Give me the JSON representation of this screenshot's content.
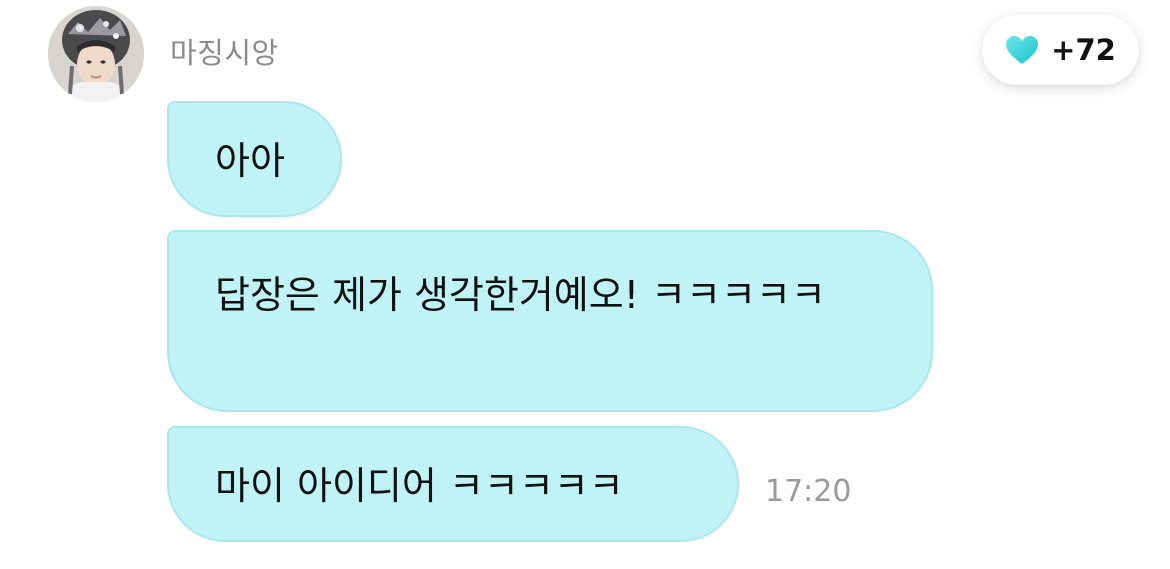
{
  "sender": {
    "name": "마징시앙",
    "avatar": "profile-photo"
  },
  "reaction": {
    "icon": "heart-icon",
    "color": "#2bd4db",
    "count": "+72"
  },
  "messages": [
    {
      "text": "아아"
    },
    {
      "text": "답장은 제가 생각한거예오! ㅋㅋㅋㅋㅋ"
    },
    {
      "text": "마이 아이디어 ㅋㅋㅋㅋㅋ",
      "time": "17:20"
    }
  ],
  "colors": {
    "bubble": "#bff3f6",
    "bubble_border": "#a9e7ee",
    "timestamp": "#9a9a9a",
    "sender": "#8a8a8a"
  }
}
